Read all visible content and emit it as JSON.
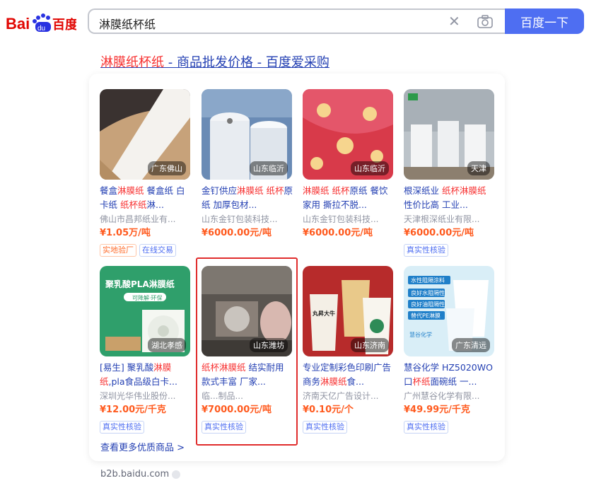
{
  "header": {
    "logo_text_left": "Bai",
    "logo_text_right": "百度",
    "search_query": "淋膜纸杯纸",
    "search_button": "百度一下"
  },
  "result": {
    "title_highlight": "淋膜纸杯纸",
    "title_rest": " - 商品批发价格 - 百度爱采购",
    "more_link": "查看更多优质商品 >",
    "source": "b2b.baidu.com"
  },
  "products": [
    {
      "location": "广东佛山",
      "title": [
        {
          "t": "餐盒"
        },
        {
          "t": "淋膜纸",
          "hl": true
        },
        {
          "t": " 餐盒纸 白卡纸 "
        },
        {
          "t": "纸杯纸",
          "hl": true
        },
        {
          "t": "淋..."
        }
      ],
      "company": "佛山市昌邦纸业有...",
      "price": "¥1.05万/吨",
      "tags": [
        {
          "text": "实地验厂",
          "style": "orange"
        },
        {
          "text": "在线交易",
          "style": "blue"
        }
      ]
    },
    {
      "location": "山东临沂",
      "title": [
        {
          "t": "金钉供应"
        },
        {
          "t": "淋膜纸",
          "hl": true
        },
        {
          "t": " "
        },
        {
          "t": "纸杯",
          "hl": true
        },
        {
          "t": "原纸 加厚包材..."
        }
      ],
      "company": "山东金钉包装科技...",
      "price": "¥6000.00元/吨",
      "tags": []
    },
    {
      "location": "山东临沂",
      "title": [
        {
          "t": "淋膜纸",
          "hl": true
        },
        {
          "t": " "
        },
        {
          "t": "纸杯",
          "hl": true
        },
        {
          "t": "原纸 餐饮家用 撕拉不脱..."
        }
      ],
      "company": "山东金钉包装科技...",
      "price": "¥6000.00元/吨",
      "tags": []
    },
    {
      "location": "天津",
      "title": [
        {
          "t": "根深纸业 "
        },
        {
          "t": "纸杯淋膜纸",
          "hl": true
        },
        {
          "t": " 性价比高 工业..."
        }
      ],
      "company": "天津根深纸业有限...",
      "price": "¥6000.00元/吨",
      "tags": [
        {
          "text": "真实性核验",
          "style": "blue"
        }
      ]
    },
    {
      "location": "湖北孝感",
      "title": [
        {
          "t": "[易生] 聚乳酸"
        },
        {
          "t": "淋膜纸",
          "hl": true
        },
        {
          "t": ",pla食品级白卡..."
        }
      ],
      "company": "深圳光华伟业股份...",
      "price": "¥12.00元/千克",
      "tags": [
        {
          "text": "真实性核验",
          "style": "blue"
        }
      ]
    },
    {
      "location": "山东潍坊",
      "title": [
        {
          "t": "纸杯淋膜纸",
          "hl": true
        },
        {
          "t": " 结实耐用 款式丰富 厂家..."
        }
      ],
      "company": "临...制品...",
      "price": "¥7000.00元/吨",
      "tags": [
        {
          "text": "真实性核验",
          "style": "blue"
        }
      ]
    },
    {
      "location": "山东济南",
      "title": [
        {
          "t": "专业定制彩色印刷广告商务"
        },
        {
          "t": "淋膜纸",
          "hl": true
        },
        {
          "t": "食..."
        }
      ],
      "company": "济南天亿广告设计...",
      "price": "¥0.10元/个",
      "tags": [
        {
          "text": "真实性核验",
          "style": "blue"
        }
      ]
    },
    {
      "location": "广东清远",
      "title": [
        {
          "t": "慧谷化学 HZ5020WO口"
        },
        {
          "t": "杯纸",
          "hl": true
        },
        {
          "t": "面碗纸 一..."
        }
      ],
      "company": "广州慧谷化学有限...",
      "price": "¥49.99元/千克",
      "tags": [
        {
          "text": "真实性核验",
          "style": "blue"
        }
      ]
    }
  ],
  "image_texts": {
    "p5_banner": "聚乳酸PLA淋膜纸",
    "p5_sub": "可降解·环保",
    "p7_cup": "丸昇大牛",
    "p8_banner1": "水性阻隔涂料",
    "p8_banner2": "良好水阻隔性",
    "p8_banner3": "良好油阻隔性",
    "p8_banner4": "替代PE淋膜",
    "p8_brand": "慧谷化学"
  },
  "colors": {
    "link": "#2440b3",
    "highlight": "#f73131",
    "price": "#ff5a1e",
    "brand_blue": "#4e6ef2",
    "annotation_box": "#e02d2d"
  }
}
